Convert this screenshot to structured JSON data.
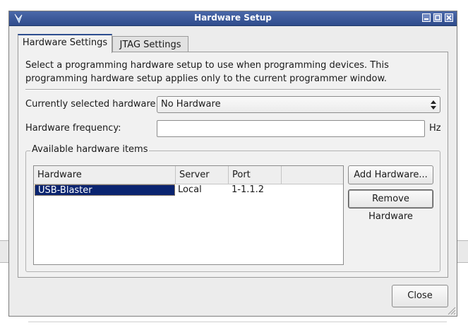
{
  "window": {
    "title": "Hardware Setup",
    "icon": "intel-app-icon",
    "controls": [
      "minimize-icon",
      "maximize-icon",
      "close-icon"
    ]
  },
  "tabs": [
    {
      "label": "Hardware Settings",
      "active": true
    },
    {
      "label": "JTAG Settings",
      "active": false
    }
  ],
  "settings": {
    "description": "Select a programming hardware setup to use when programming devices. This programming hardware setup applies only to the current programmer window.",
    "current_hardware_label": "Currently selected hardware:",
    "current_hardware_value": "No Hardware",
    "frequency_label": "Hardware frequency:",
    "frequency_value": "",
    "frequency_unit": "Hz"
  },
  "available": {
    "group_title": "Available hardware items",
    "columns": [
      "Hardware",
      "Server",
      "Port"
    ],
    "rows": [
      {
        "hardware": "USB-Blaster",
        "server": "Local",
        "port": "1-1.1.2",
        "selected": true
      }
    ],
    "add_button": "Add Hardware...",
    "remove_button": "Remove Hardware"
  },
  "footer": {
    "close_button": "Close"
  },
  "colors": {
    "titlebar": "#2f4c8c",
    "selection": "#0a2470",
    "dialog_bg": "#ececec"
  }
}
